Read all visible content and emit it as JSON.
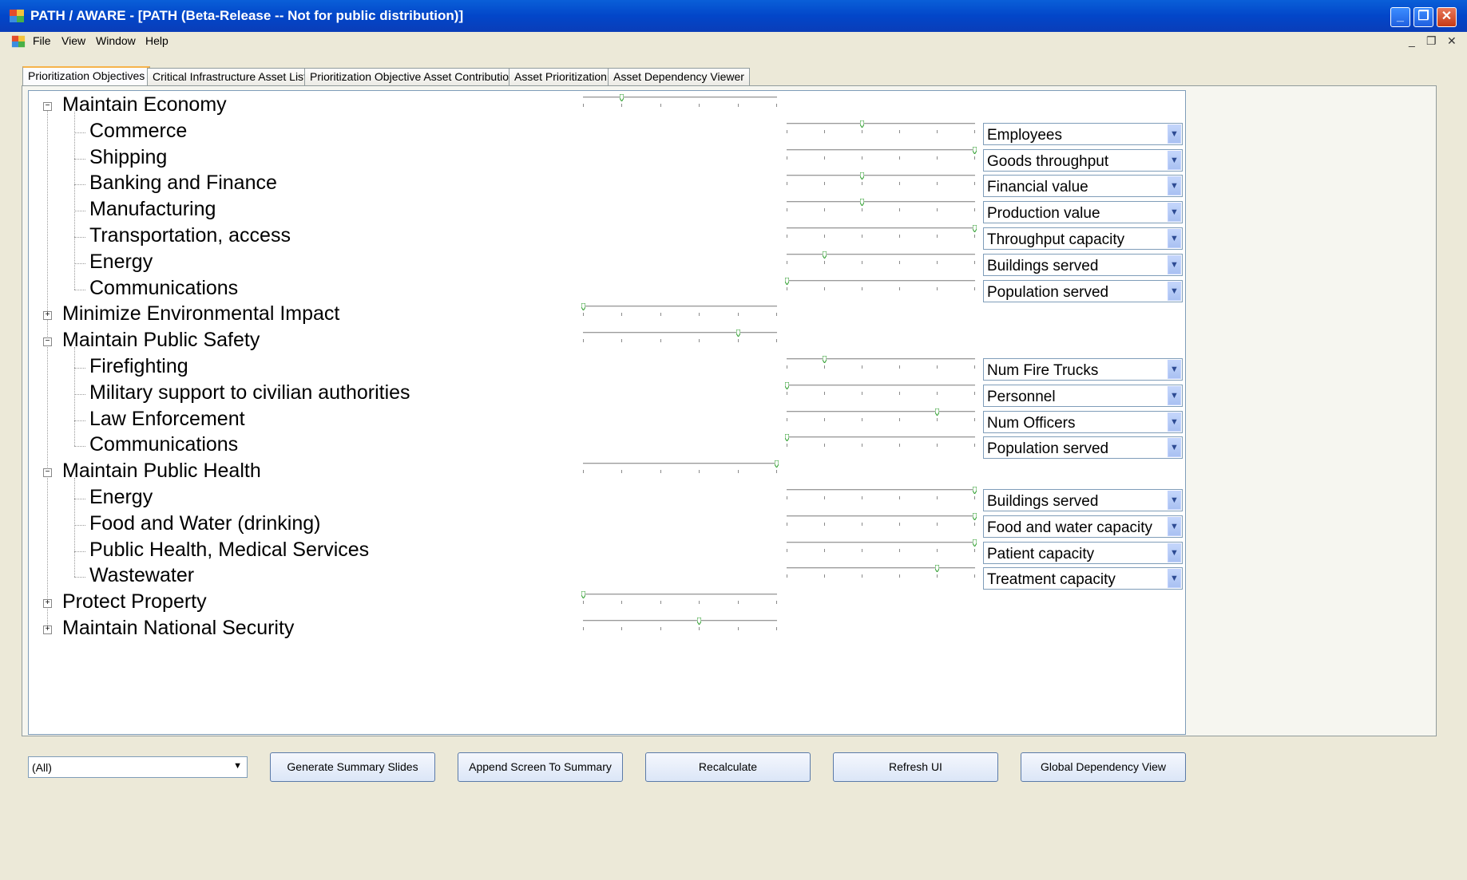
{
  "window": {
    "title": "PATH / AWARE - [PATH (Beta-Release -- Not for public distribution)]"
  },
  "menu": [
    "File",
    "View",
    "Window",
    "Help"
  ],
  "tabs": [
    "Prioritization Objectives",
    "Critical Infrastructure Asset List",
    "Prioritization Objective Asset Contribution",
    "Asset Prioritization",
    "Asset Dependency Viewer"
  ],
  "active_tab": 0,
  "tree": [
    {
      "level": 0,
      "label": "Maintain Economy",
      "expanded": true,
      "weight": 0.2
    },
    {
      "level": 1,
      "label": "Commerce",
      "weight": 0.4,
      "measure": "Employees"
    },
    {
      "level": 1,
      "label": "Shipping",
      "weight": 1.0,
      "measure": "Goods throughput"
    },
    {
      "level": 1,
      "label": "Banking and Finance",
      "weight": 0.4,
      "measure": "Financial value"
    },
    {
      "level": 1,
      "label": "Manufacturing",
      "weight": 0.4,
      "measure": "Production value"
    },
    {
      "level": 1,
      "label": "Transportation, access",
      "weight": 1.0,
      "measure": "Throughput capacity"
    },
    {
      "level": 1,
      "label": "Energy",
      "weight": 0.2,
      "measure": "Buildings served"
    },
    {
      "level": 1,
      "label": "Communications",
      "weight": 0.0,
      "measure": "Population served"
    },
    {
      "level": 0,
      "label": "Minimize Environmental Impact",
      "expanded": false,
      "weight": 0.0
    },
    {
      "level": 0,
      "label": "Maintain Public Safety",
      "expanded": true,
      "weight": 0.8
    },
    {
      "level": 1,
      "label": "Firefighting",
      "weight": 0.2,
      "measure": "Num Fire Trucks"
    },
    {
      "level": 1,
      "label": "Military support to civilian authorities",
      "weight": 0.0,
      "measure": "Personnel"
    },
    {
      "level": 1,
      "label": "Law Enforcement",
      "weight": 0.8,
      "measure": "Num Officers"
    },
    {
      "level": 1,
      "label": "Communications",
      "weight": 0.0,
      "measure": "Population served"
    },
    {
      "level": 0,
      "label": "Maintain Public Health",
      "expanded": true,
      "weight": 1.0
    },
    {
      "level": 1,
      "label": "Energy",
      "weight": 1.0,
      "measure": "Buildings served"
    },
    {
      "level": 1,
      "label": "Food and Water (drinking)",
      "weight": 1.0,
      "measure": "Food and water capacity"
    },
    {
      "level": 1,
      "label": "Public Health, Medical Services",
      "weight": 1.0,
      "measure": "Patient capacity"
    },
    {
      "level": 1,
      "label": "Wastewater",
      "weight": 0.8,
      "measure": "Treatment capacity"
    },
    {
      "level": 0,
      "label": "Protect Property",
      "expanded": false,
      "weight": 0.0
    },
    {
      "level": 0,
      "label": "Maintain National Security",
      "expanded": false,
      "weight": 0.6
    }
  ],
  "filter": {
    "value": "(All)"
  },
  "buttons": [
    "Generate Summary Slides",
    "Append Screen To Summary",
    "Recalculate",
    "Refresh UI",
    "Global Dependency View"
  ],
  "colors": {
    "title_bar": "#0a5fd8",
    "slider_thumb": "#2e9e2e",
    "active_tab": "#f6b34b"
  },
  "icons": [
    "app-icon",
    "minimize-icon",
    "restore-icon",
    "close-icon",
    "tree-expand-icon",
    "tree-collapse-icon",
    "dropdown-arrow-icon"
  ]
}
